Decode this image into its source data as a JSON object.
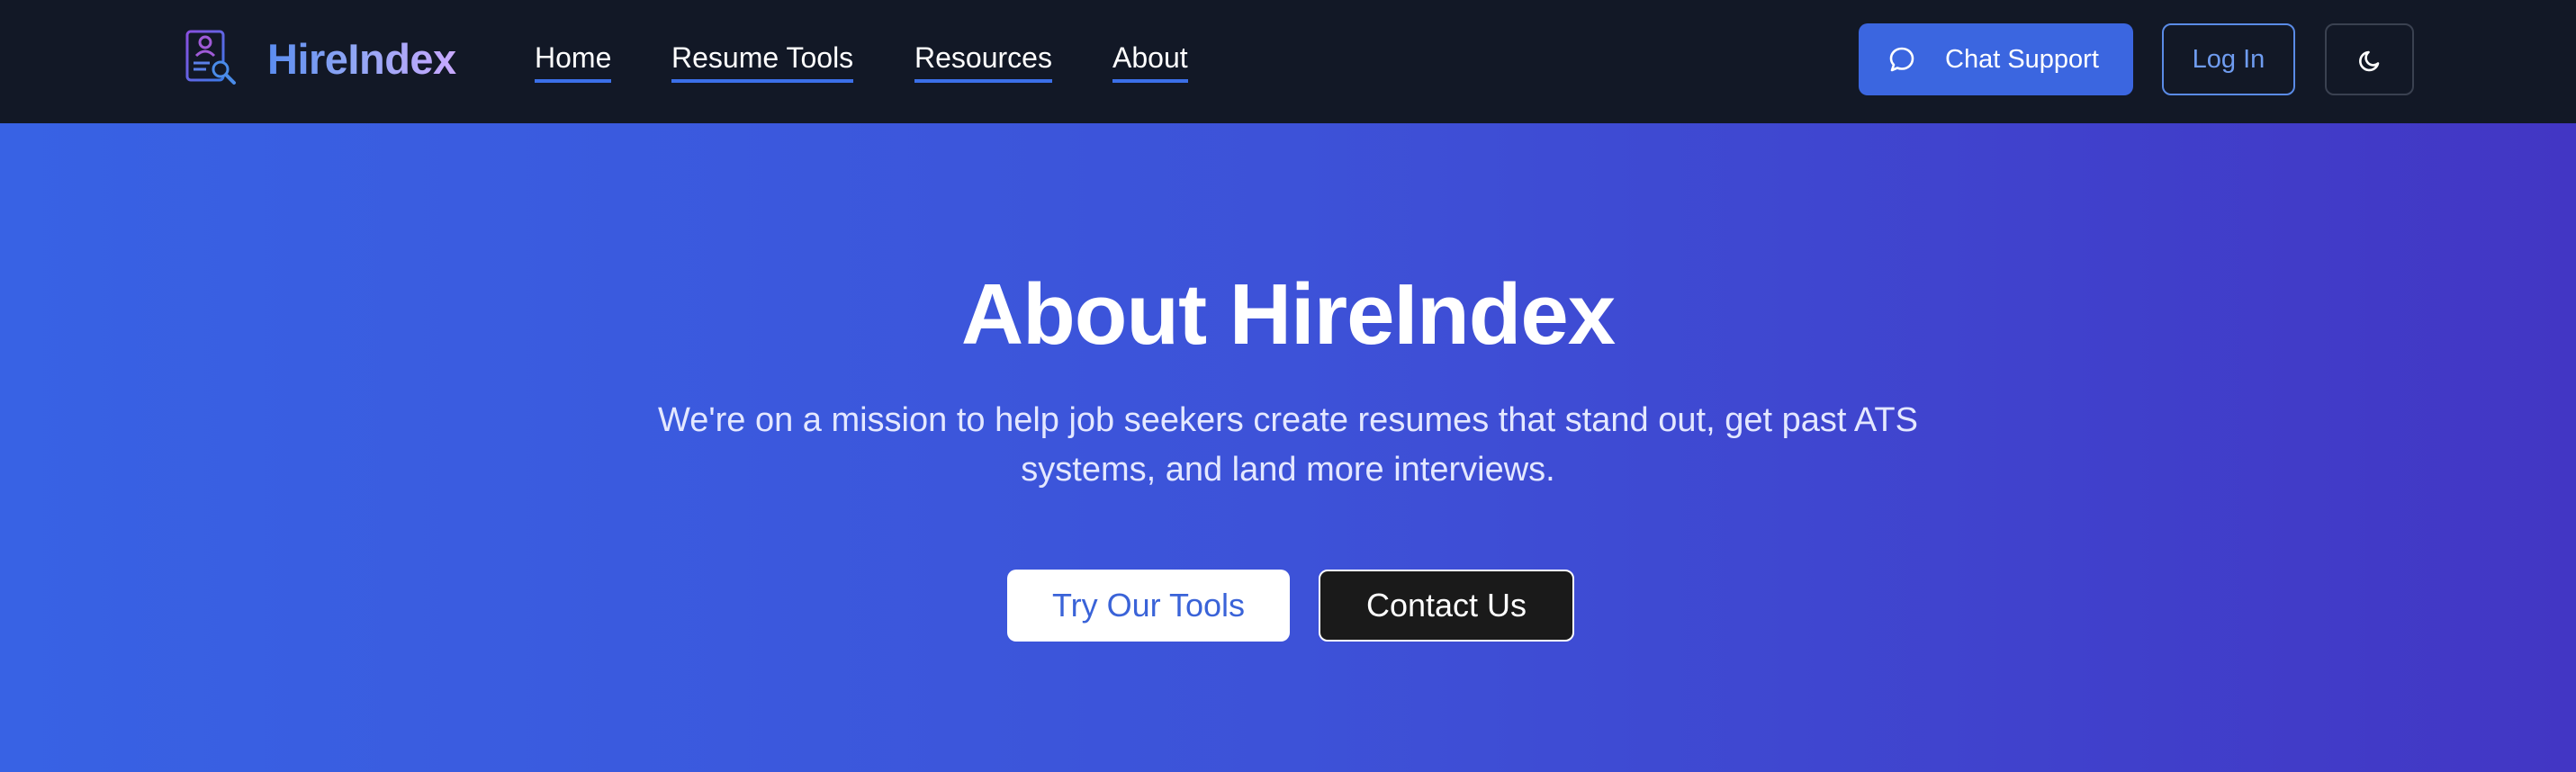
{
  "brand": {
    "name": "HireIndex",
    "logo_icon": "resume-search-icon"
  },
  "nav": {
    "links": [
      {
        "label": "Home"
      },
      {
        "label": "Resume Tools"
      },
      {
        "label": "Resources"
      },
      {
        "label": "About"
      }
    ],
    "chat_support": {
      "label": "Chat Support",
      "icon": "chat-bubble-icon"
    },
    "login": {
      "label": "Log In"
    },
    "theme_toggle": {
      "icon": "moon-icon"
    }
  },
  "hero": {
    "title": "About HireIndex",
    "subtitle": "We're on a mission to help job seekers create resumes that stand out, get past ATS systems, and land more interviews.",
    "primary_cta": "Try Our Tools",
    "secondary_cta": "Contact Us"
  },
  "colors": {
    "nav_bg": "#121826",
    "accent": "#3b66e0",
    "hero_gradient_start": "#3862e4",
    "hero_gradient_end": "#4236c4"
  }
}
